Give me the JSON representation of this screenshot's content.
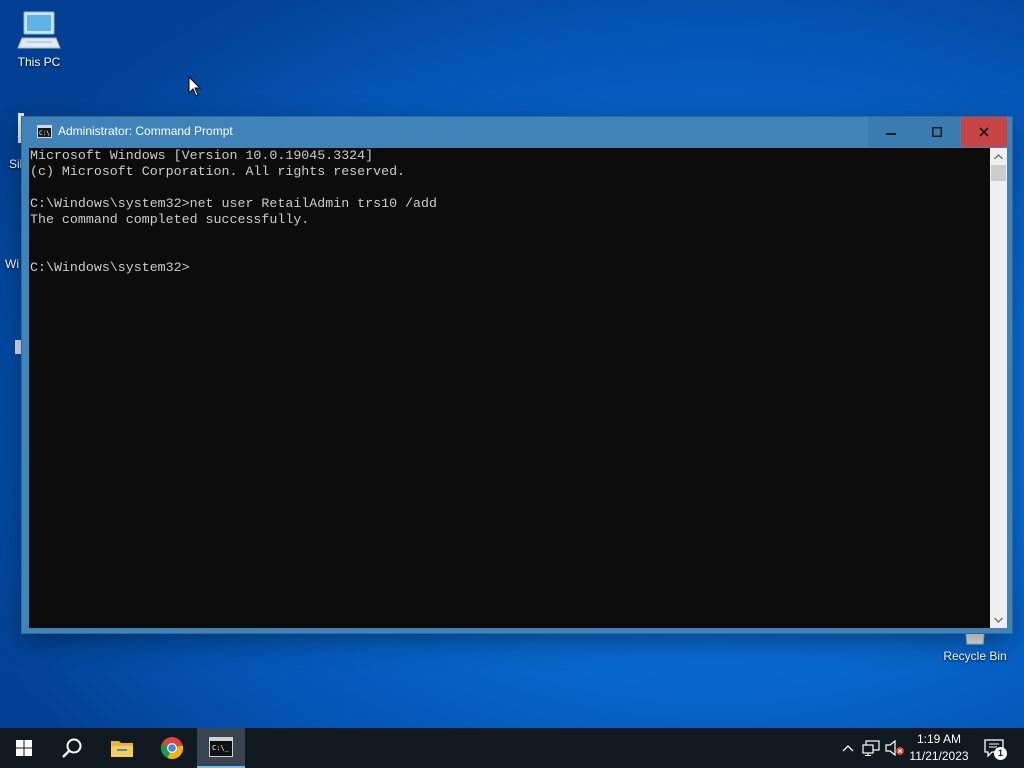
{
  "desktop": {
    "icons": [
      {
        "label": "This PC"
      },
      {
        "label": "Recycle Bin"
      }
    ],
    "partial_labels": [
      "Sil",
      "Wi"
    ]
  },
  "window": {
    "title": "Administrator: Command Prompt",
    "title_icon": "cmd-icon",
    "buttons": {
      "minimize": "minimize-icon",
      "maximize": "maximize-icon",
      "close": "close-icon"
    },
    "console_lines": [
      "Microsoft Windows [Version 10.0.19045.3324]",
      "(c) Microsoft Corporation. All rights reserved.",
      "",
      "C:\\Windows\\system32>net user RetailAdmin trs10 /add",
      "The command completed successfully.",
      "",
      "",
      "C:\\Windows\\system32>"
    ],
    "colors": {
      "titlebar": "#3f83b8",
      "console_bg": "#0c0c0c",
      "console_fg": "#cccccc",
      "close_btn": "#c94545"
    }
  },
  "taskbar": {
    "items": [
      {
        "name": "start",
        "icon": "windows-logo-icon"
      },
      {
        "name": "search",
        "icon": "search-icon"
      },
      {
        "name": "file-explorer",
        "icon": "folder-icon"
      },
      {
        "name": "chrome",
        "icon": "chrome-icon"
      },
      {
        "name": "command-prompt",
        "icon": "cmd-icon",
        "active": true
      }
    ],
    "tray": {
      "icons": [
        "chevron-up-icon",
        "network-icon",
        "volume-muted-icon"
      ],
      "time": "1:19 AM",
      "date": "11/21/2023",
      "notification_count": "1"
    }
  }
}
